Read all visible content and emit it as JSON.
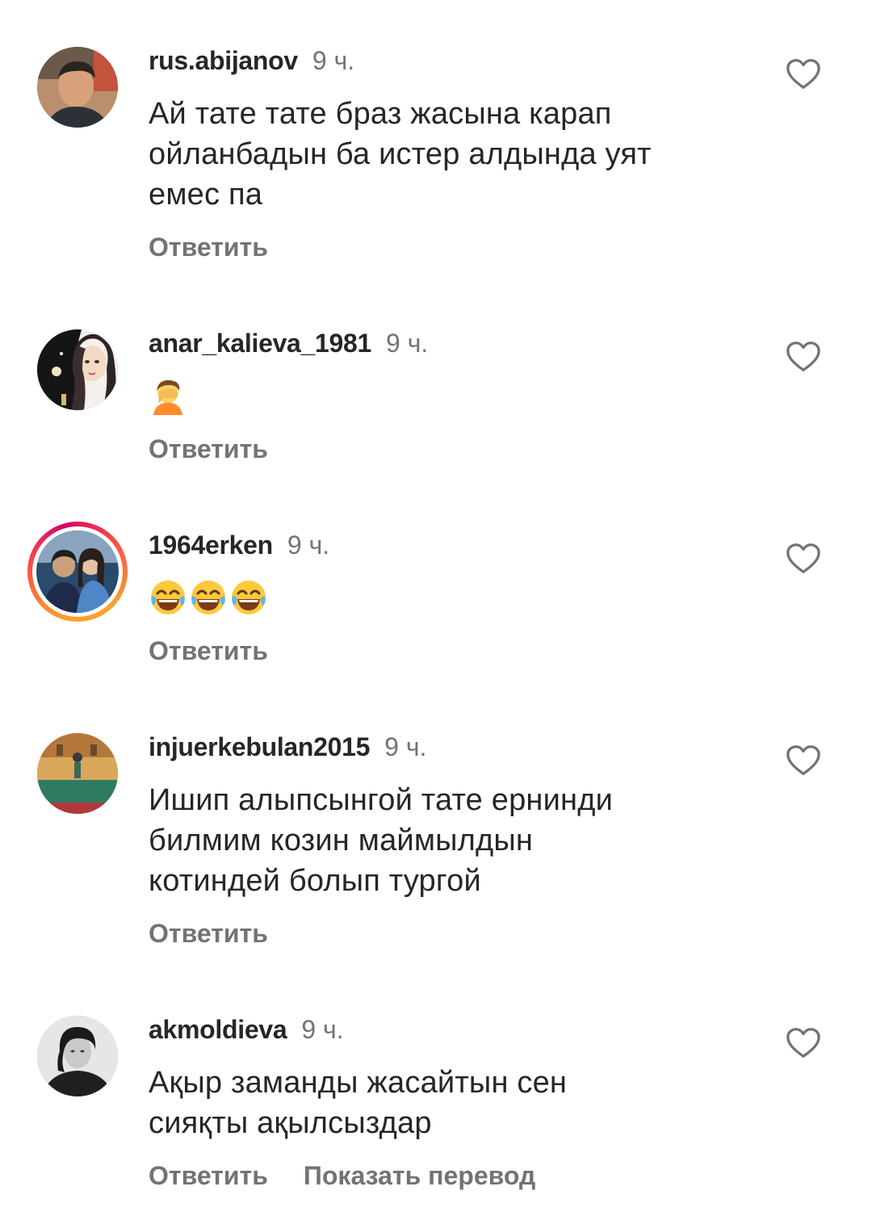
{
  "comments": [
    {
      "username": "rus.abijanov",
      "time": "9 ч.",
      "text_lines": [
        "Ай тате тате браз жасына карап",
        "ойланбадын ба истер алдында уят",
        "емес па"
      ],
      "reply": "Ответить"
    },
    {
      "username": "anar_kalieva_1981",
      "time": "9 ч.",
      "emoji": [
        "person-facepalming"
      ],
      "reply": "Ответить"
    },
    {
      "username": "1964erken",
      "time": "9 ч.",
      "emoji": [
        "face-with-tears-of-joy",
        "face-with-tears-of-joy",
        "face-with-tears-of-joy"
      ],
      "reply": "Ответить",
      "has_story": true
    },
    {
      "username": "injuerkebulan2015",
      "time": "9 ч.",
      "text_lines": [
        "Ишип алыпсынгой тате ернинди",
        "билмим козин маймылдын",
        "котиндей болып тургой"
      ],
      "reply": "Ответить"
    },
    {
      "username": "akmoldieva",
      "time": "9 ч.",
      "text_lines": [
        "Ақыр заманды жасайтын сен",
        "сияқты ақылсыздар"
      ],
      "reply": "Ответить",
      "translate": "Показать перевод"
    }
  ],
  "colors": {
    "text": "#262626",
    "secondary": "#737373",
    "background": "#ffffff"
  },
  "icons": {
    "like": "heart-outline-icon"
  }
}
